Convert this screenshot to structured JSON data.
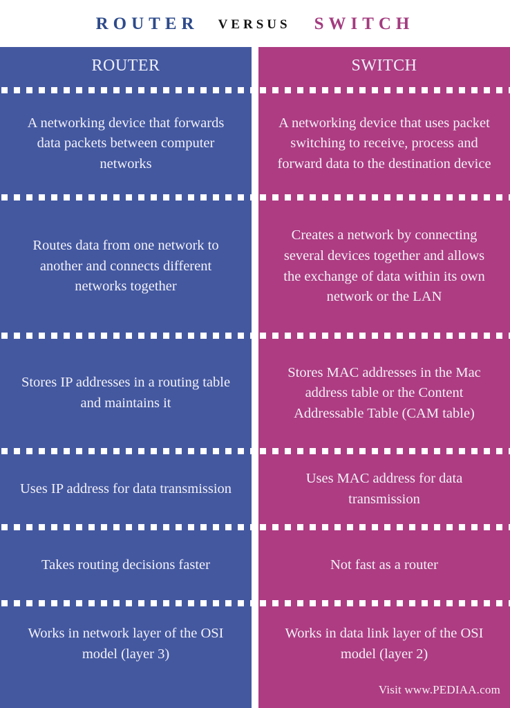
{
  "title": {
    "left": "ROUTER",
    "middle": "VERSUS",
    "right": "SWITCH",
    "left_color": "#2d4a8a",
    "middle_color": "#141414",
    "right_color": "#a33b7f"
  },
  "columns": {
    "left": {
      "header": "ROUTER",
      "background_color": "#4458a0",
      "rows": [
        "A networking device that forwards data packets between computer networks",
        "Routes data from one network to another and connects different networks together",
        "Stores IP addresses in a routing table and maintains it",
        "Uses IP address for data transmission",
        "Takes routing decisions faster",
        "Works in network layer of the OSI model (layer 3)"
      ]
    },
    "right": {
      "header": "SWITCH",
      "background_color": "#ad3c82",
      "rows": [
        "A networking device that uses packet switching to receive, process and forward data to the destination device",
        "Creates a network by connecting several devices together and allows the exchange of data within its own network or the LAN",
        "Stores MAC addresses in the Mac address table or the Content Addressable Table (CAM table)",
        "Uses MAC address for data transmission",
        "Not fast as a router",
        "Works in data link layer of the OSI model (layer 2)"
      ]
    }
  },
  "footer": {
    "credit": "Visit www.PEDIAA.com"
  }
}
